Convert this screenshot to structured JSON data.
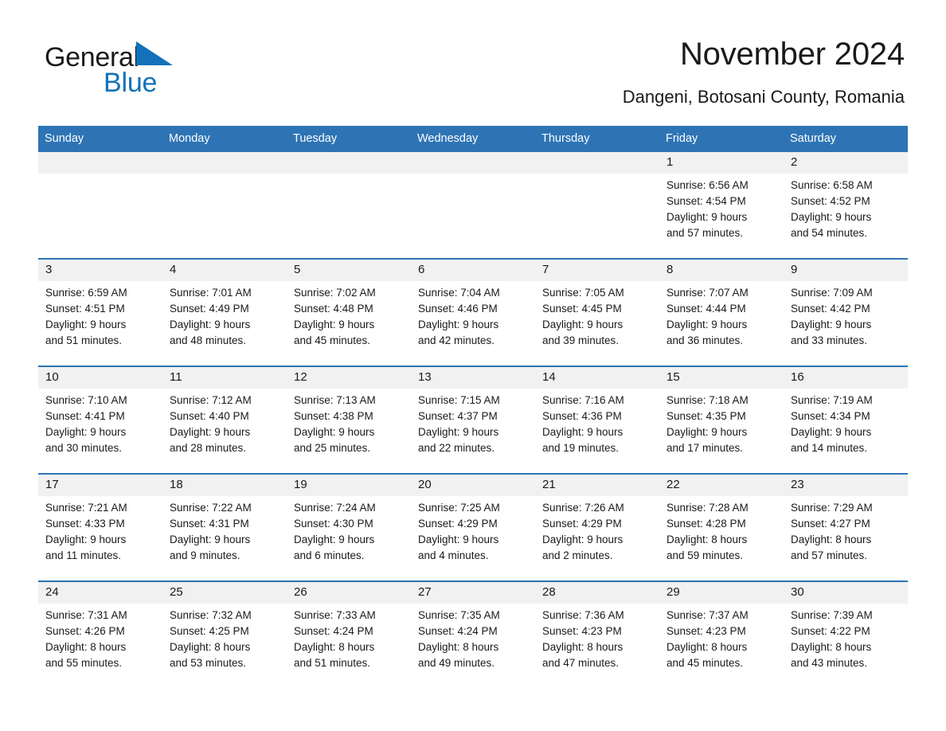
{
  "brand": {
    "name_part1": "General",
    "name_part2": "Blue",
    "triangle_color": "#1271b8"
  },
  "header": {
    "month_title": "November 2024",
    "location": "Dangeni, Botosani County, Romania"
  },
  "theme": {
    "header_blue": "#2e74b5",
    "daynum_band": "#f1f1f1",
    "text": "#1a1a1a",
    "white": "#ffffff"
  },
  "calendar": {
    "weekday_headers": [
      "Sunday",
      "Monday",
      "Tuesday",
      "Wednesday",
      "Thursday",
      "Friday",
      "Saturday"
    ],
    "weeks": [
      [
        {
          "day": "",
          "empty": true,
          "sunrise": "",
          "sunset": "",
          "daylight_1": "",
          "daylight_2": ""
        },
        {
          "day": "",
          "empty": true,
          "sunrise": "",
          "sunset": "",
          "daylight_1": "",
          "daylight_2": ""
        },
        {
          "day": "",
          "empty": true,
          "sunrise": "",
          "sunset": "",
          "daylight_1": "",
          "daylight_2": ""
        },
        {
          "day": "",
          "empty": true,
          "sunrise": "",
          "sunset": "",
          "daylight_1": "",
          "daylight_2": ""
        },
        {
          "day": "",
          "empty": true,
          "sunrise": "",
          "sunset": "",
          "daylight_1": "",
          "daylight_2": ""
        },
        {
          "day": "1",
          "empty": false,
          "sunrise": "Sunrise: 6:56 AM",
          "sunset": "Sunset: 4:54 PM",
          "daylight_1": "Daylight: 9 hours",
          "daylight_2": "and 57 minutes."
        },
        {
          "day": "2",
          "empty": false,
          "sunrise": "Sunrise: 6:58 AM",
          "sunset": "Sunset: 4:52 PM",
          "daylight_1": "Daylight: 9 hours",
          "daylight_2": "and 54 minutes."
        }
      ],
      [
        {
          "day": "3",
          "empty": false,
          "sunrise": "Sunrise: 6:59 AM",
          "sunset": "Sunset: 4:51 PM",
          "daylight_1": "Daylight: 9 hours",
          "daylight_2": "and 51 minutes."
        },
        {
          "day": "4",
          "empty": false,
          "sunrise": "Sunrise: 7:01 AM",
          "sunset": "Sunset: 4:49 PM",
          "daylight_1": "Daylight: 9 hours",
          "daylight_2": "and 48 minutes."
        },
        {
          "day": "5",
          "empty": false,
          "sunrise": "Sunrise: 7:02 AM",
          "sunset": "Sunset: 4:48 PM",
          "daylight_1": "Daylight: 9 hours",
          "daylight_2": "and 45 minutes."
        },
        {
          "day": "6",
          "empty": false,
          "sunrise": "Sunrise: 7:04 AM",
          "sunset": "Sunset: 4:46 PM",
          "daylight_1": "Daylight: 9 hours",
          "daylight_2": "and 42 minutes."
        },
        {
          "day": "7",
          "empty": false,
          "sunrise": "Sunrise: 7:05 AM",
          "sunset": "Sunset: 4:45 PM",
          "daylight_1": "Daylight: 9 hours",
          "daylight_2": "and 39 minutes."
        },
        {
          "day": "8",
          "empty": false,
          "sunrise": "Sunrise: 7:07 AM",
          "sunset": "Sunset: 4:44 PM",
          "daylight_1": "Daylight: 9 hours",
          "daylight_2": "and 36 minutes."
        },
        {
          "day": "9",
          "empty": false,
          "sunrise": "Sunrise: 7:09 AM",
          "sunset": "Sunset: 4:42 PM",
          "daylight_1": "Daylight: 9 hours",
          "daylight_2": "and 33 minutes."
        }
      ],
      [
        {
          "day": "10",
          "empty": false,
          "sunrise": "Sunrise: 7:10 AM",
          "sunset": "Sunset: 4:41 PM",
          "daylight_1": "Daylight: 9 hours",
          "daylight_2": "and 30 minutes."
        },
        {
          "day": "11",
          "empty": false,
          "sunrise": "Sunrise: 7:12 AM",
          "sunset": "Sunset: 4:40 PM",
          "daylight_1": "Daylight: 9 hours",
          "daylight_2": "and 28 minutes."
        },
        {
          "day": "12",
          "empty": false,
          "sunrise": "Sunrise: 7:13 AM",
          "sunset": "Sunset: 4:38 PM",
          "daylight_1": "Daylight: 9 hours",
          "daylight_2": "and 25 minutes."
        },
        {
          "day": "13",
          "empty": false,
          "sunrise": "Sunrise: 7:15 AM",
          "sunset": "Sunset: 4:37 PM",
          "daylight_1": "Daylight: 9 hours",
          "daylight_2": "and 22 minutes."
        },
        {
          "day": "14",
          "empty": false,
          "sunrise": "Sunrise: 7:16 AM",
          "sunset": "Sunset: 4:36 PM",
          "daylight_1": "Daylight: 9 hours",
          "daylight_2": "and 19 minutes."
        },
        {
          "day": "15",
          "empty": false,
          "sunrise": "Sunrise: 7:18 AM",
          "sunset": "Sunset: 4:35 PM",
          "daylight_1": "Daylight: 9 hours",
          "daylight_2": "and 17 minutes."
        },
        {
          "day": "16",
          "empty": false,
          "sunrise": "Sunrise: 7:19 AM",
          "sunset": "Sunset: 4:34 PM",
          "daylight_1": "Daylight: 9 hours",
          "daylight_2": "and 14 minutes."
        }
      ],
      [
        {
          "day": "17",
          "empty": false,
          "sunrise": "Sunrise: 7:21 AM",
          "sunset": "Sunset: 4:33 PM",
          "daylight_1": "Daylight: 9 hours",
          "daylight_2": "and 11 minutes."
        },
        {
          "day": "18",
          "empty": false,
          "sunrise": "Sunrise: 7:22 AM",
          "sunset": "Sunset: 4:31 PM",
          "daylight_1": "Daylight: 9 hours",
          "daylight_2": "and 9 minutes."
        },
        {
          "day": "19",
          "empty": false,
          "sunrise": "Sunrise: 7:24 AM",
          "sunset": "Sunset: 4:30 PM",
          "daylight_1": "Daylight: 9 hours",
          "daylight_2": "and 6 minutes."
        },
        {
          "day": "20",
          "empty": false,
          "sunrise": "Sunrise: 7:25 AM",
          "sunset": "Sunset: 4:29 PM",
          "daylight_1": "Daylight: 9 hours",
          "daylight_2": "and 4 minutes."
        },
        {
          "day": "21",
          "empty": false,
          "sunrise": "Sunrise: 7:26 AM",
          "sunset": "Sunset: 4:29 PM",
          "daylight_1": "Daylight: 9 hours",
          "daylight_2": "and 2 minutes."
        },
        {
          "day": "22",
          "empty": false,
          "sunrise": "Sunrise: 7:28 AM",
          "sunset": "Sunset: 4:28 PM",
          "daylight_1": "Daylight: 8 hours",
          "daylight_2": "and 59 minutes."
        },
        {
          "day": "23",
          "empty": false,
          "sunrise": "Sunrise: 7:29 AM",
          "sunset": "Sunset: 4:27 PM",
          "daylight_1": "Daylight: 8 hours",
          "daylight_2": "and 57 minutes."
        }
      ],
      [
        {
          "day": "24",
          "empty": false,
          "sunrise": "Sunrise: 7:31 AM",
          "sunset": "Sunset: 4:26 PM",
          "daylight_1": "Daylight: 8 hours",
          "daylight_2": "and 55 minutes."
        },
        {
          "day": "25",
          "empty": false,
          "sunrise": "Sunrise: 7:32 AM",
          "sunset": "Sunset: 4:25 PM",
          "daylight_1": "Daylight: 8 hours",
          "daylight_2": "and 53 minutes."
        },
        {
          "day": "26",
          "empty": false,
          "sunrise": "Sunrise: 7:33 AM",
          "sunset": "Sunset: 4:24 PM",
          "daylight_1": "Daylight: 8 hours",
          "daylight_2": "and 51 minutes."
        },
        {
          "day": "27",
          "empty": false,
          "sunrise": "Sunrise: 7:35 AM",
          "sunset": "Sunset: 4:24 PM",
          "daylight_1": "Daylight: 8 hours",
          "daylight_2": "and 49 minutes."
        },
        {
          "day": "28",
          "empty": false,
          "sunrise": "Sunrise: 7:36 AM",
          "sunset": "Sunset: 4:23 PM",
          "daylight_1": "Daylight: 8 hours",
          "daylight_2": "and 47 minutes."
        },
        {
          "day": "29",
          "empty": false,
          "sunrise": "Sunrise: 7:37 AM",
          "sunset": "Sunset: 4:23 PM",
          "daylight_1": "Daylight: 8 hours",
          "daylight_2": "and 45 minutes."
        },
        {
          "day": "30",
          "empty": false,
          "sunrise": "Sunrise: 7:39 AM",
          "sunset": "Sunset: 4:22 PM",
          "daylight_1": "Daylight: 8 hours",
          "daylight_2": "and 43 minutes."
        }
      ]
    ]
  }
}
